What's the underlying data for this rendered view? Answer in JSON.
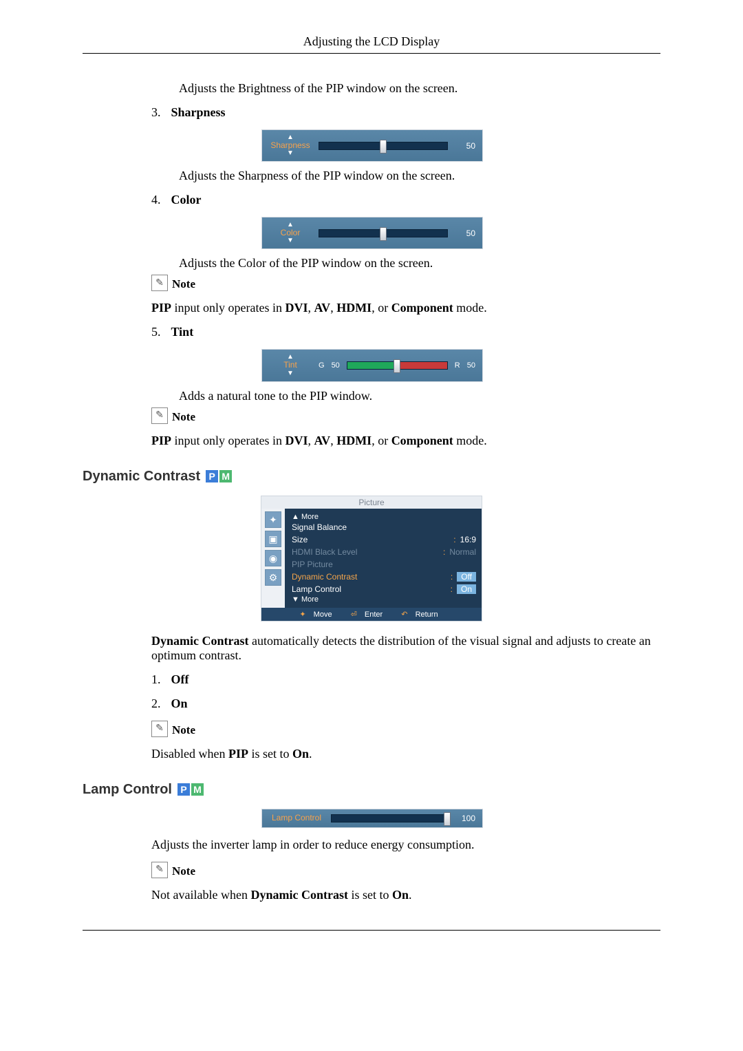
{
  "header": "Adjusting the LCD Display",
  "intro_brightness": "Adjusts the Brightness of the PIP window on the screen.",
  "items": {
    "3": {
      "num": "3.",
      "title": "Sharpness",
      "desc": "Adjusts the Sharpness of the PIP window on the screen."
    },
    "4": {
      "num": "4.",
      "title": "Color",
      "desc": "Adjusts the Color of the PIP window on the screen."
    },
    "5": {
      "num": "5.",
      "title": "Tint",
      "desc": "Adds a natural tone to the PIP window."
    }
  },
  "note_label": "Note",
  "pip_modes_prefix": "PIP",
  "pip_modes_mid": " input only operates in ",
  "pip_modes_b1": "DVI",
  "pip_modes_b2": "AV",
  "pip_modes_b3": "HDMI",
  "pip_modes_b4": "Component",
  "pip_modes_suffix": " mode.",
  "osd": {
    "sharpness": {
      "label": "Sharpness",
      "value": "50",
      "pos": 50
    },
    "color": {
      "label": "Color",
      "value": "50",
      "pos": 50
    },
    "tint": {
      "label": "Tint",
      "g": "G",
      "gval": "50",
      "r": "R",
      "rval": "50",
      "pos": 50
    },
    "lamp": {
      "label": "Lamp Control",
      "value": "100",
      "pos": 100
    }
  },
  "dynamic_contrast": {
    "heading": "Dynamic Contrast",
    "menu_title": "Picture",
    "menu": {
      "more_up": "▲ More",
      "signal_balance": "Signal Balance",
      "size_l": "Size",
      "size_v": "16:9",
      "hdmi_l": "HDMI Black Level",
      "hdmi_v": "Normal",
      "pip_l": "PIP Picture",
      "dc_l": "Dynamic Contrast",
      "dc_v": "Off",
      "lamp_l": "Lamp Control",
      "lamp_v": "On",
      "more_down": "▼ More",
      "foot_move": "Move",
      "foot_enter": "Enter",
      "foot_return": "Return"
    },
    "desc_b": "Dynamic Contrast",
    "desc_rest": " automatically detects the distribution of the visual signal and adjusts to create an optimum contrast.",
    "opt1n": "1.",
    "opt1": "Off",
    "opt2n": "2.",
    "opt2": "On",
    "note_prefix": "Disabled when ",
    "note_b1": "PIP",
    "note_mid": " is set to ",
    "note_b2": "On",
    "note_suffix": "."
  },
  "lamp_control": {
    "heading": "Lamp Control",
    "desc": "Adjusts the inverter lamp in order to reduce energy consumption.",
    "note_prefix": "Not available when ",
    "note_b1": "Dynamic Contrast",
    "note_mid": " is set to ",
    "note_b2": "On",
    "note_suffix": "."
  }
}
